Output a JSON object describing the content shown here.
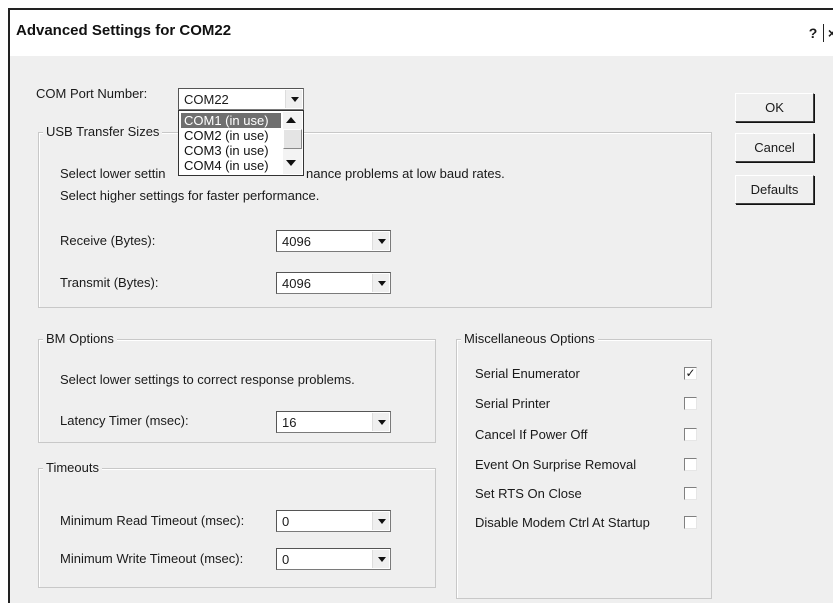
{
  "window": {
    "title": "Advanced Settings for COM22",
    "help_label": "?",
    "close_label": "×"
  },
  "com_port": {
    "label": "COM Port Number:",
    "value": "COM22",
    "options": [
      "COM1 (in use)",
      "COM2 (in use)",
      "COM3 (in use)",
      "COM4 (in use)"
    ],
    "highlighted": "COM1 (in use)"
  },
  "buttons": {
    "ok": "OK",
    "cancel": "Cancel",
    "defaults": "Defaults"
  },
  "usb": {
    "title": "USB Transfer Sizes",
    "desc1_left": "Select lower settin",
    "desc1_right": "nance problems at low baud rates.",
    "desc2": "Select higher settings for faster performance.",
    "receive_label": "Receive (Bytes):",
    "receive_value": "4096",
    "transmit_label": "Transmit (Bytes):",
    "transmit_value": "4096"
  },
  "bm": {
    "title": "BM Options",
    "desc": "Select lower settings to correct response problems.",
    "latency_label": "Latency Timer (msec):",
    "latency_value": "16"
  },
  "timeouts": {
    "title": "Timeouts",
    "read_label": "Minimum Read Timeout (msec):",
    "read_value": "0",
    "write_label": "Minimum Write Timeout (msec):",
    "write_value": "0"
  },
  "misc": {
    "title": "Miscellaneous Options",
    "options": [
      {
        "label": "Serial Enumerator",
        "checked": true,
        "mark": "✓"
      },
      {
        "label": "Serial Printer",
        "checked": false,
        "mark": ""
      },
      {
        "label": "Cancel If Power Off",
        "checked": false,
        "mark": ""
      },
      {
        "label": "Event On Surprise Removal",
        "checked": false,
        "mark": ""
      },
      {
        "label": "Set RTS On Close",
        "checked": false,
        "mark": ""
      },
      {
        "label": "Disable Modem Ctrl At Startup",
        "checked": false,
        "mark": ""
      }
    ]
  }
}
